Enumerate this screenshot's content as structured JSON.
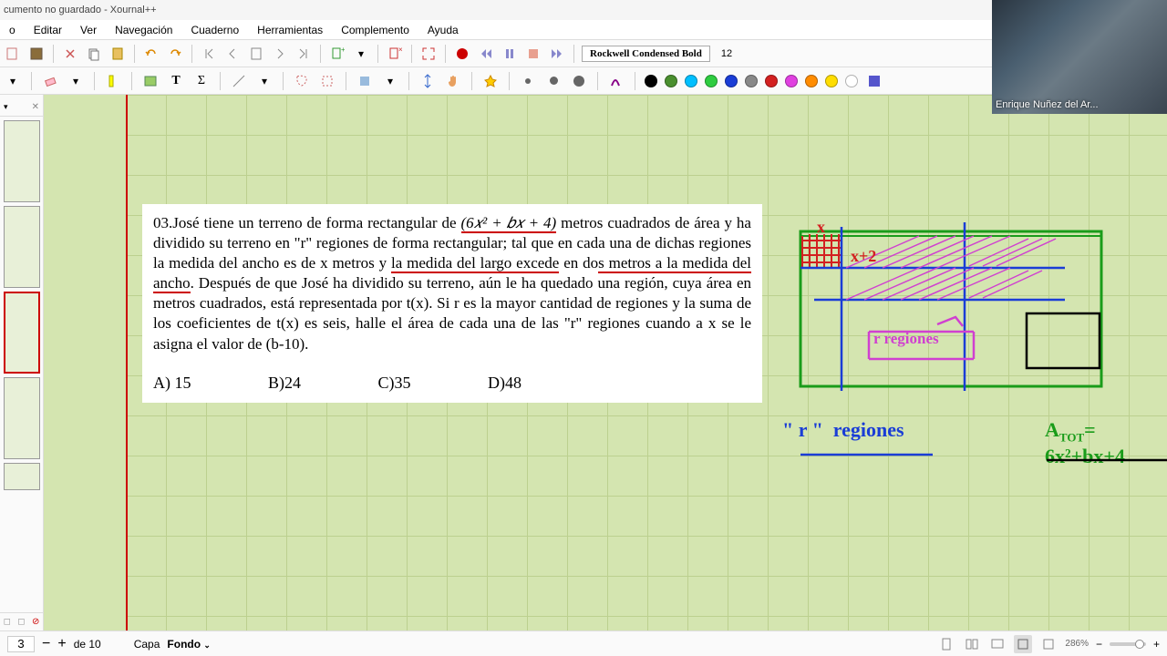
{
  "title": "cumento no guardado - Xournal++",
  "menu": {
    "archivo": "o",
    "editar": "Editar",
    "ver": "Ver",
    "navegacion": "Navegación",
    "cuaderno": "Cuaderno",
    "herramientas": "Herramientas",
    "complemento": "Complemento",
    "ayuda": "Ayuda"
  },
  "font": {
    "name": "Rockwell Condensed Bold",
    "size": "12"
  },
  "colors": {
    "c1": "#000000",
    "c2": "#4a8f2f",
    "c3": "#00bfff",
    "c4": "#2ecc40",
    "c5": "#1a3dd6",
    "c6": "#888888",
    "c7": "#d32020",
    "c8": "#e040e0",
    "c9": "#ff8c00",
    "c10": "#ffdd00",
    "c11": "#ffffff"
  },
  "problem": {
    "prefix": "03.José tiene un terreno de forma rectangular de ",
    "formula": "(6𝑥² + 𝑏𝑥 + 4)",
    "rest": " metros cuadrados de área y ha dividido su terreno en \"r\" regiones de forma rectangular; tal que en cada una de dichas regiones la medida del ancho es de x metros y ",
    "u1": "la medida del largo excede",
    "rest2": " en do",
    "u2": "s metros a la medida del ancho",
    "rest3": ". Después de que José ha dividido su terreno, aún le ha quedado una región, cuya área en metros cuadrados, está representada por t(x). Si r es la mayor cantidad de regiones y la suma de los coeficientes de t(x) es seis, halle el área de cada una de las \"r\" regiones cuando a x se le asigna el valor de (b-10).",
    "optA": "A)   15",
    "optB": "B)24",
    "optC": "C)35",
    "optD": "D)48"
  },
  "handwriting": {
    "x": "x",
    "xp2": "x+2",
    "rreg": "r regiones",
    "rreg2a": "\" r \"",
    "rreg2b": "regiones",
    "atot": "A",
    "atotsub": "TOT",
    "atoteq": "= 6x²+bx+4"
  },
  "status": {
    "page": "3",
    "of": "de 10",
    "layer": "Capa",
    "layername": "Fondo",
    "zoom": "286%"
  },
  "video": {
    "name": "Enrique Nuñez del Ar..."
  }
}
